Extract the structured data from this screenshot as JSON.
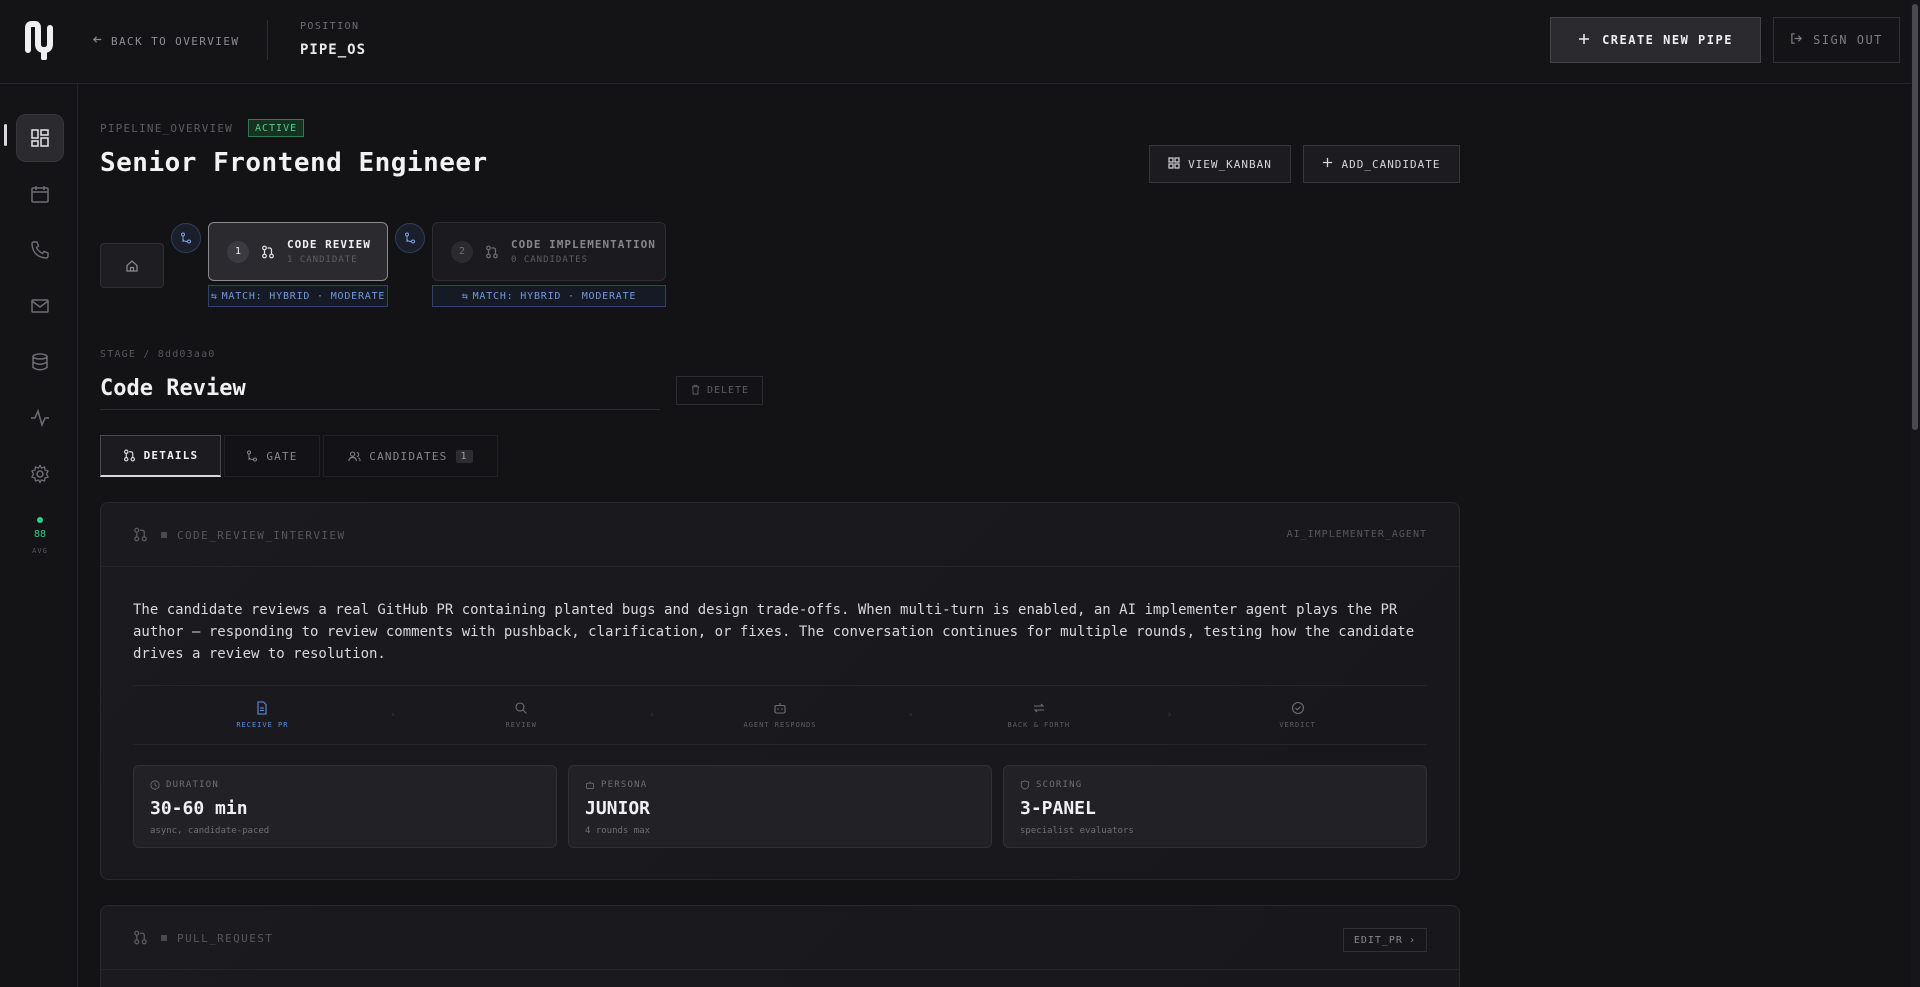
{
  "header": {
    "back_label": "BACK TO OVERVIEW",
    "position_label": "POSITION",
    "position_value": "PIPE_OS",
    "create_label": "CREATE NEW PIPE",
    "signout_label": "SIGN OUT"
  },
  "sidebar": {
    "items": [
      {
        "name": "dashboard",
        "icon": "dashboard-icon",
        "active": true
      },
      {
        "name": "calendar",
        "icon": "calendar-icon",
        "active": false
      },
      {
        "name": "calls",
        "icon": "phone-icon",
        "active": false
      },
      {
        "name": "mail",
        "icon": "mail-icon",
        "active": false
      },
      {
        "name": "database",
        "icon": "database-icon",
        "active": false
      },
      {
        "name": "activity",
        "icon": "activity-icon",
        "active": false
      },
      {
        "name": "settings",
        "icon": "gear-icon",
        "active": false
      }
    ],
    "avg_value": "88",
    "avg_label": "AVG"
  },
  "pipeline": {
    "overview_label": "PIPELINE_OVERVIEW",
    "status": "ACTIVE",
    "title": "Senior Frontend Engineer",
    "view_kanban_label": "VIEW_KANBAN",
    "add_candidate_label": "ADD_CANDIDATE",
    "stages": [
      {
        "number": "1",
        "name": "CODE REVIEW",
        "count": "1 CANDIDATE",
        "match": "MATCH: HYBRID · MODERATE"
      },
      {
        "number": "2",
        "name": "CODE IMPLEMENTATION",
        "count": "0 CANDIDATES",
        "match": "MATCH: HYBRID · MODERATE"
      }
    ]
  },
  "stage": {
    "id_label": "STAGE / 8dd03aa0",
    "title": "Code Review",
    "delete_label": "DELETE",
    "tabs": [
      {
        "label": "DETAILS",
        "active": true
      },
      {
        "label": "GATE",
        "active": false
      },
      {
        "label": "CANDIDATES",
        "count": "1",
        "active": false
      }
    ]
  },
  "interview_panel": {
    "label": "CODE_REVIEW_INTERVIEW",
    "agent": "AI_IMPLEMENTER_AGENT",
    "description": "The candidate reviews a real GitHub PR containing planted bugs and design trade-offs. When multi-turn is enabled, an AI implementer agent plays the PR author — responding to review comments with pushback, clarification, or fixes. The conversation continues for multiple rounds, testing how the candidate drives a review to resolution.",
    "flow": [
      {
        "label": "RECEIVE PR",
        "icon": "file-icon",
        "active": true
      },
      {
        "label": "REVIEW",
        "icon": "search-icon",
        "active": false
      },
      {
        "label": "AGENT RESPONDS",
        "icon": "bot-icon",
        "active": false
      },
      {
        "label": "BACK & FORTH",
        "icon": "repeat-icon",
        "active": false
      },
      {
        "label": "VERDICT",
        "icon": "check-circle-icon",
        "active": false
      }
    ],
    "stats": [
      {
        "label": "DURATION",
        "value": "30-60 min",
        "sub": "async, candidate-paced",
        "icon": "clock-icon"
      },
      {
        "label": "PERSONA",
        "value": "JUNIOR",
        "sub": "4 rounds max",
        "icon": "bot-icon"
      },
      {
        "label": "SCORING",
        "value": "3-PANEL",
        "sub": "specialist evaluators",
        "icon": "shield-icon"
      }
    ]
  },
  "pr_panel": {
    "label": "PULL_REQUEST",
    "edit_label": "EDIT_PR"
  },
  "colors": {
    "background": "#131316",
    "accent_blue": "#5b8fe0",
    "status_green": "#4ad38a"
  }
}
